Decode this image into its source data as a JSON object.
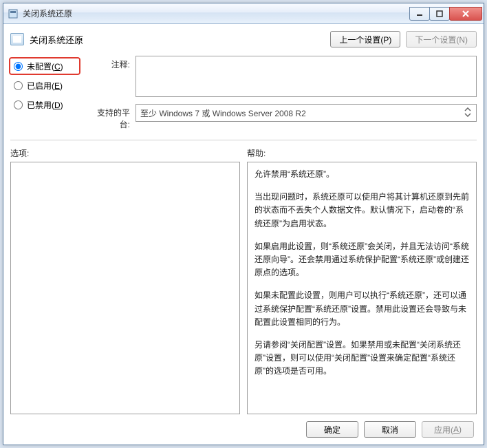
{
  "window": {
    "title": "关闭系统还原"
  },
  "header": {
    "title": "关闭系统还原",
    "prev_button": "上一个设置(P)",
    "next_button": "下一个设置(N)"
  },
  "radios": {
    "not_configured": "未配置(C)",
    "enabled": "已启用(E)",
    "disabled": "已禁用(D)",
    "selected": "not_configured"
  },
  "fields": {
    "comment_label": "注释:",
    "comment_value": "",
    "platform_label": "支持的平台:",
    "platform_value": "至少 Windows 7 或 Windows Server 2008 R2"
  },
  "section_labels": {
    "options": "选项:",
    "help": "帮助:"
  },
  "help_text": {
    "p1": "允许禁用“系统还原”。",
    "p2": "当出现问题时，系统还原可以使用户将其计算机还原到先前的状态而不丢失个人数据文件。默认情况下，启动卷的“系统还原”为启用状态。",
    "p3": "如果启用此设置，则“系统还原”会关闭，并且无法访问“系统还原向导”。还会禁用通过系统保护配置“系统还原”或创建还原点的选项。",
    "p4": "如果未配置此设置，则用户可以执行“系统还原”，还可以通过系统保护配置“系统还原”设置。禁用此设置还会导致与未配置此设置相同的行为。",
    "p5": "另请参阅“关闭配置”设置。如果禁用或未配置“关闭系统还原”设置，则可以使用“关闭配置”设置来确定配置“系统还原”的选项是否可用。"
  },
  "footer": {
    "ok": "确定",
    "cancel": "取消",
    "apply": "应用(A)"
  }
}
